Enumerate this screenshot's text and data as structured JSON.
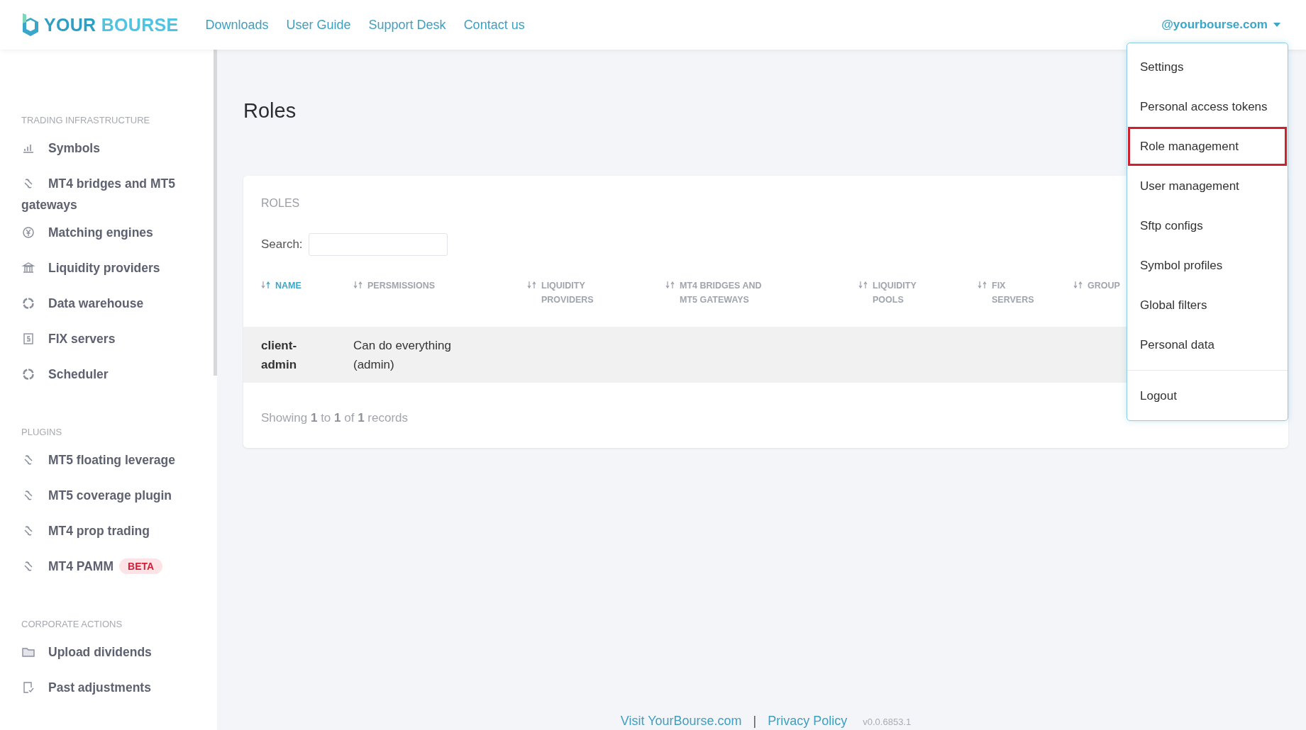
{
  "header": {
    "logo": {
      "word_1": "YOUR",
      "word_2": "BOURSE"
    },
    "nav": [
      "Downloads",
      "User Guide",
      "Support Desk",
      "Contact us"
    ],
    "account": "@yourbourse.com"
  },
  "account_menu": {
    "items": [
      {
        "label": "Settings",
        "highlighted": false,
        "divider_before": false
      },
      {
        "label": "Personal access tokens",
        "highlighted": false,
        "divider_before": false
      },
      {
        "label": "Role management",
        "highlighted": true,
        "divider_before": false
      },
      {
        "label": "User management",
        "highlighted": false,
        "divider_before": false
      },
      {
        "label": "Sftp configs",
        "highlighted": false,
        "divider_before": false
      },
      {
        "label": "Symbol profiles",
        "highlighted": false,
        "divider_before": false
      },
      {
        "label": "Global filters",
        "highlighted": false,
        "divider_before": false
      },
      {
        "label": "Personal data",
        "highlighted": false,
        "divider_before": false
      },
      {
        "label": "Logout",
        "highlighted": false,
        "divider_before": true
      }
    ]
  },
  "sidebar": {
    "sections": [
      {
        "title": "TRADING INFRASTRUCTURE",
        "items": [
          {
            "label": "Symbols",
            "kind": "chart"
          },
          {
            "label": "MT4 bridges and MT5 gateways",
            "kind": "link"
          },
          {
            "label": "Matching engines",
            "kind": "yen"
          },
          {
            "label": "Liquidity providers",
            "kind": "bank"
          },
          {
            "label": "Data warehouse",
            "kind": "ring"
          },
          {
            "label": "FIX servers",
            "kind": "doc"
          },
          {
            "label": "Scheduler",
            "kind": "ring"
          }
        ]
      },
      {
        "title": "PLUGINS",
        "items": [
          {
            "label": "MT5 floating leverage",
            "kind": "link"
          },
          {
            "label": "MT5 coverage plugin",
            "kind": "link"
          },
          {
            "label": "MT4 prop trading",
            "kind": "link"
          },
          {
            "label": "MT4 PAMM",
            "kind": "link",
            "badge": "BETA"
          }
        ]
      },
      {
        "title": "CORPORATE ACTIONS",
        "items": [
          {
            "label": "Upload dividends",
            "kind": "folder"
          },
          {
            "label": "Past adjustments",
            "kind": "edit"
          }
        ]
      }
    ]
  },
  "page_title": "Roles",
  "card": {
    "title": "ROLES",
    "search_label": "Search:",
    "table": {
      "columns": [
        {
          "label": "NAME",
          "selected": true
        },
        {
          "label": "PERSMISSIONS",
          "selected": false
        },
        {
          "label": "LIQUIDITY PROVIDERS",
          "selected": false
        },
        {
          "label": "MT4 BRIDGES AND MT5 GATEWAYS",
          "selected": false
        },
        {
          "label": "LIQUIDITY POOLS",
          "selected": false
        },
        {
          "label": "FIX SERVERS",
          "selected": false
        },
        {
          "label": "GROUP",
          "selected": false
        }
      ],
      "rows": [
        {
          "cells": [
            "client-admin",
            "Can do everything (admin)"
          ]
        }
      ]
    },
    "info": "Showing **1** to **1** of **1** records"
  },
  "footer": {
    "links": [
      "Visit YourBourse.com",
      "Privacy Policy"
    ],
    "separator": "|",
    "version": "v0.0.6853.1"
  }
}
